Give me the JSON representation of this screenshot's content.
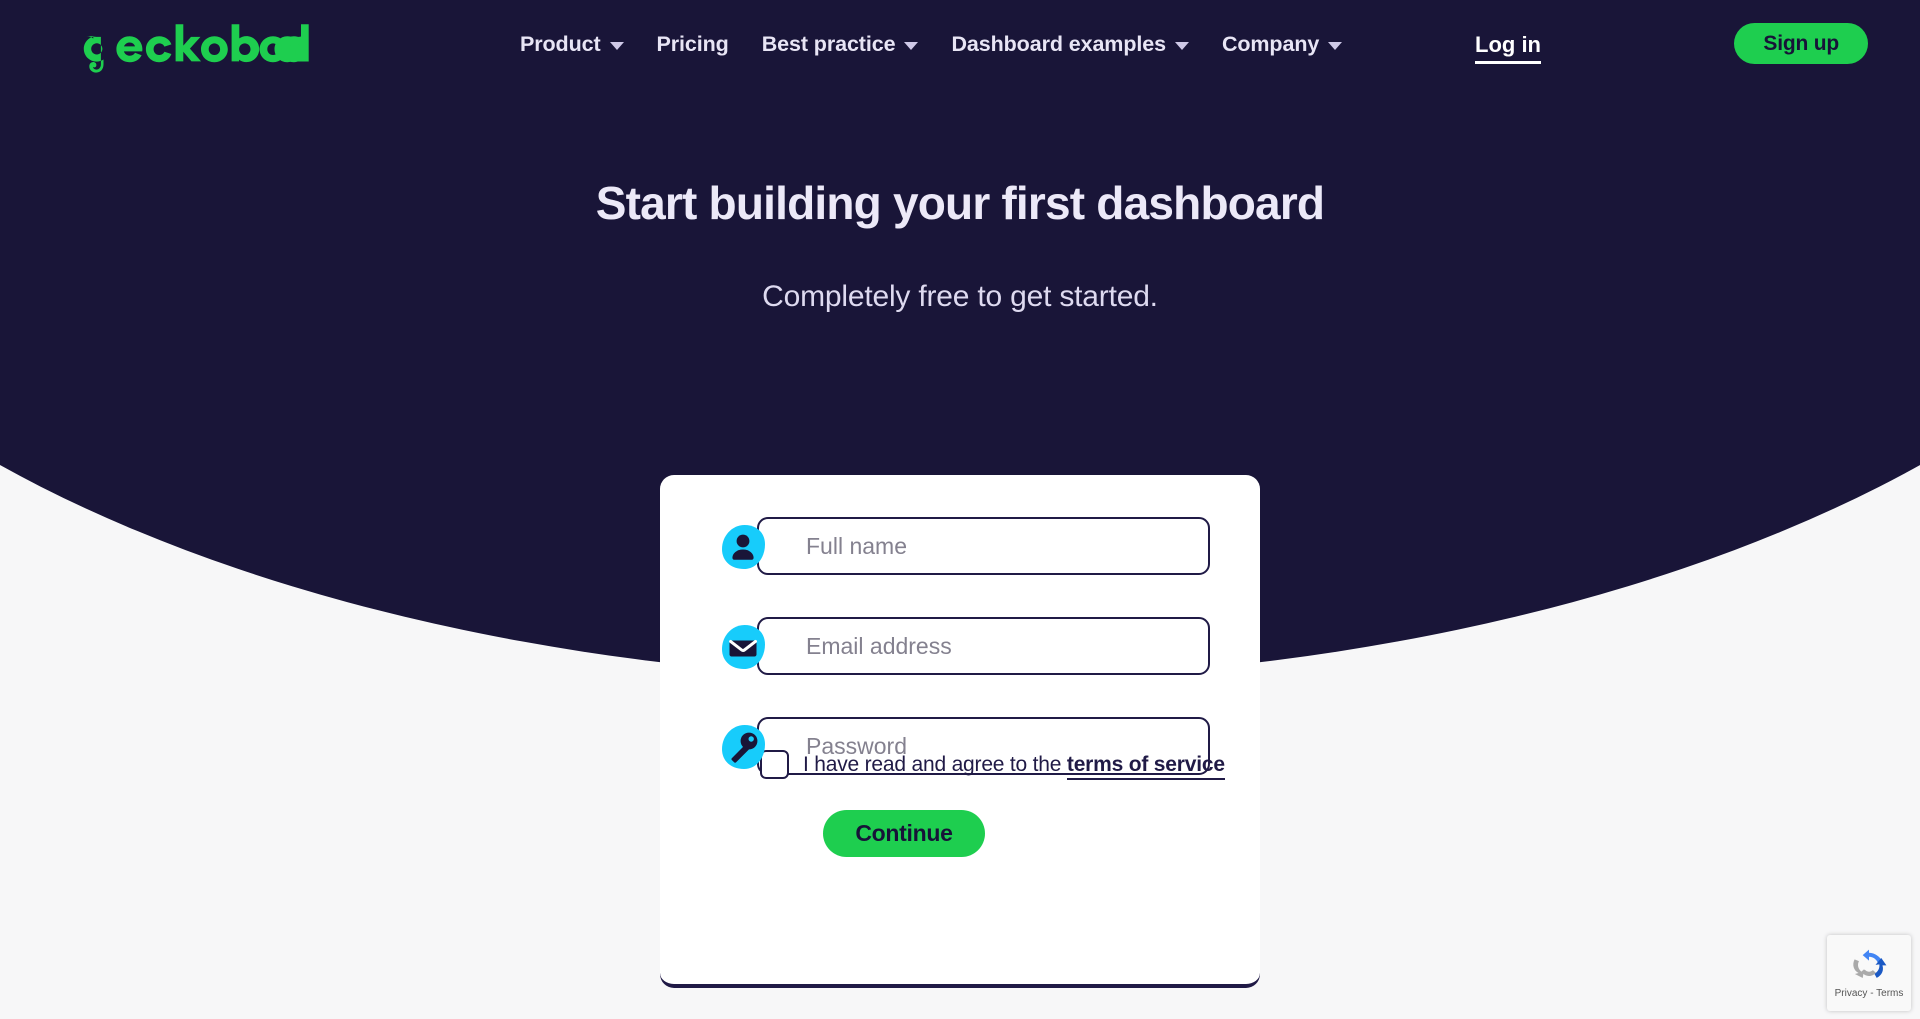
{
  "brand": {
    "name": "geckoboard",
    "logo_color": "#1ece4f",
    "dark_color": "#191538",
    "accent_cyan": "#17ccfb",
    "accent_green": "#1ece4f"
  },
  "header": {
    "nav": [
      {
        "label": "Product",
        "has_dropdown": true
      },
      {
        "label": "Pricing",
        "has_dropdown": false
      },
      {
        "label": "Best practice",
        "has_dropdown": true
      },
      {
        "label": "Dashboard examples",
        "has_dropdown": true
      },
      {
        "label": "Company",
        "has_dropdown": true
      }
    ],
    "login_label": "Log in",
    "signup_label": "Sign up"
  },
  "hero": {
    "title": "Start building your first dashboard",
    "subtitle": "Completely free to get started."
  },
  "form": {
    "fields": [
      {
        "icon": "person-icon",
        "placeholder": "Full name",
        "value": "",
        "type": "text"
      },
      {
        "icon": "envelope-icon",
        "placeholder": "Email address",
        "value": "",
        "type": "email"
      },
      {
        "icon": "key-icon",
        "placeholder": "Password",
        "value": "",
        "type": "password"
      }
    ],
    "terms_prefix": "I have read and agree to the",
    "terms_link_label": "terms of service",
    "terms_checked": false,
    "submit_label": "Continue"
  },
  "recaptcha": {
    "icon": "recaptcha-icon",
    "label": "Privacy - Terms"
  }
}
